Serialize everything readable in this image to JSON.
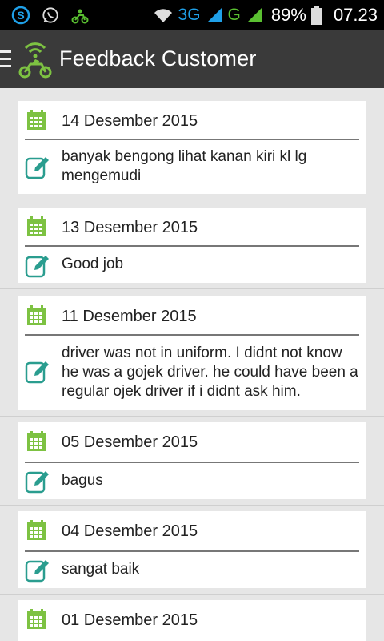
{
  "status_bar": {
    "net_3g": "3G",
    "net_g": "G",
    "battery": "89%",
    "time": "07.23"
  },
  "app_bar": {
    "title": "Feedback Customer"
  },
  "feedback": [
    {
      "date": "14 Desember 2015",
      "message": "banyak bengong lihat kanan kiri kl lg mengemudi"
    },
    {
      "date": "13 Desember 2015",
      "message": "Good job"
    },
    {
      "date": "11 Desember 2015",
      "message": "driver was not in uniform. I didnt not know he was a gojek driver. he could have been a regular ojek driver if i didnt ask him."
    },
    {
      "date": "05 Desember 2015",
      "message": "bagus"
    },
    {
      "date": "04 Desember 2015",
      "message": "sangat baik"
    },
    {
      "date": "01 Desember 2015",
      "message": ""
    }
  ],
  "colors": {
    "accent_green": "#7dc242",
    "edit_teal": "#2a9d8f",
    "app_bar": "#3a3a3a"
  },
  "icons": {
    "calendar": "calendar-icon",
    "edit": "edit-icon",
    "menu": "hamburger-icon"
  }
}
